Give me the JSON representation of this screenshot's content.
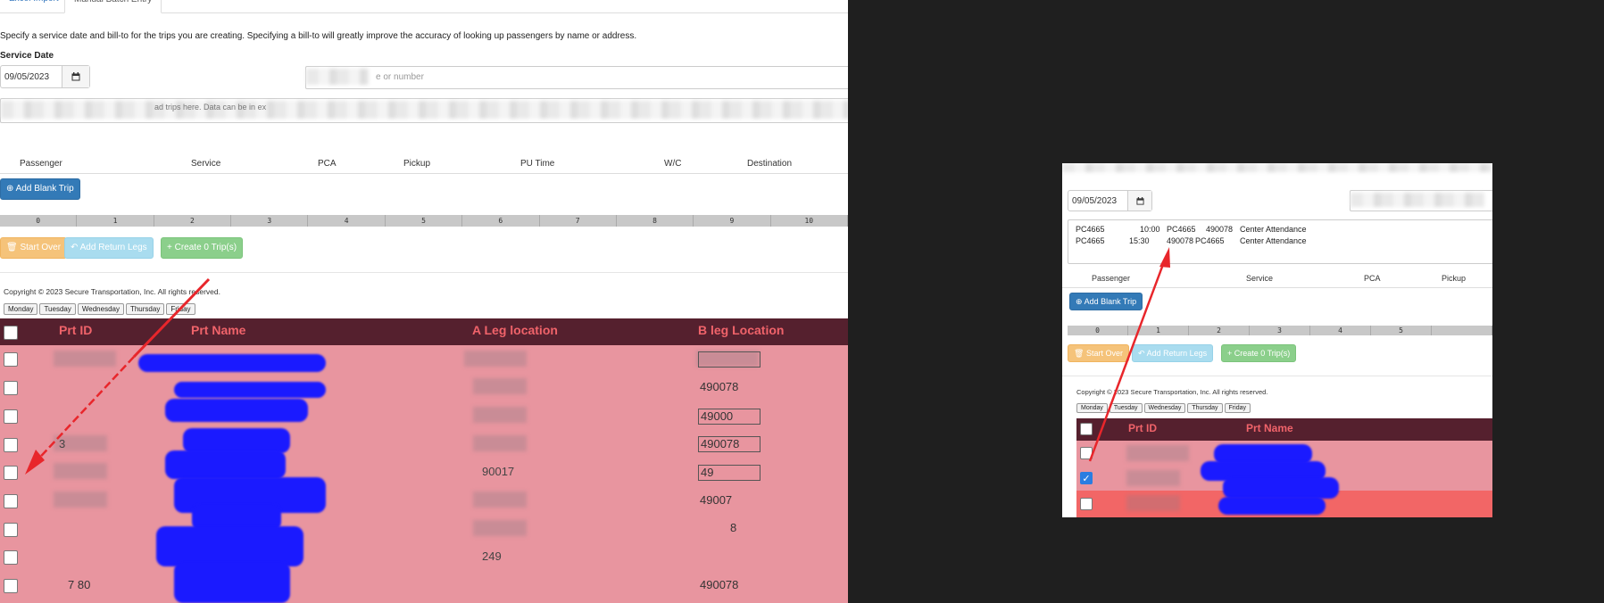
{
  "tabs": [
    "Excel Import",
    "Manual Batch Entry"
  ],
  "instructions": "Specify a service date and bill-to for the trips you are creating. Specifying a bill-to will greatly improve the accuracy of looking up passengers by name or address.",
  "service_date_label": "Service Date",
  "service_date_value": "09/05/2023",
  "billto_placeholder_fragment": "e or number",
  "paste_hint_fragment": "ad trips here. Data can be in ex",
  "table_headers": [
    "Passenger",
    "Service",
    "PCA",
    "Pickup",
    "PU Time",
    "W/C",
    "Destination"
  ],
  "add_blank_trip": "Add Blank Trip",
  "ruler_numbers": [
    "0",
    "1",
    "2",
    "3",
    "4",
    "5",
    "6",
    "7",
    "8",
    "9",
    "10"
  ],
  "buttons": {
    "start_over": "Start Over",
    "add_return_legs": "Add Return Legs",
    "create_trips": "Create 0 Trip(s)"
  },
  "copyright": "Copyright © 2023 Secure Transportation, Inc. All rights reserved.",
  "days": [
    "Monday",
    "Tuesday",
    "Wednesday",
    "Thursday",
    "Friday"
  ],
  "grid_headers": {
    "prt_id": "Prt ID",
    "prt_name": "Prt Name",
    "a_leg": "A Leg location",
    "b_leg": "B leg Location"
  },
  "left_rows": [
    {
      "b_leg": ""
    },
    {
      "b_leg": "490078"
    },
    {
      "b_leg": "49000"
    },
    {
      "b_leg": "490078"
    },
    {
      "b_leg": "49"
    },
    {
      "b_leg": "49007"
    },
    {
      "b_leg": "8"
    },
    {
      "b_leg": ""
    },
    {
      "b_leg": "490078"
    }
  ],
  "left_row_fragments": {
    "a_leg_row5": "90017",
    "a_leg_row8": "249",
    "prt_id_row9": "7 80",
    "prt_id_row4": "3"
  },
  "right_panel": {
    "paste_rows": [
      [
        "PC4665",
        "10:00",
        "PC4665",
        "490078",
        "Center Attendance"
      ],
      [
        "PC4665",
        "15:30",
        "490078",
        "PC4665",
        "Center Attendance"
      ]
    ],
    "table_headers": [
      "Passenger",
      "Service",
      "PCA",
      "Pickup"
    ],
    "ruler_numbers": [
      "0",
      "1",
      "2",
      "3",
      "4",
      "5"
    ],
    "row_checked": [
      false,
      true,
      false
    ]
  },
  "colors": {
    "grid_header_bg": "#55202e",
    "grid_header_text": "#f0636a",
    "row_pink": "#e8959f",
    "row_selected": "#f26666",
    "scribble_blue": "#1a1aff",
    "annotation_red": "#e8262b"
  }
}
